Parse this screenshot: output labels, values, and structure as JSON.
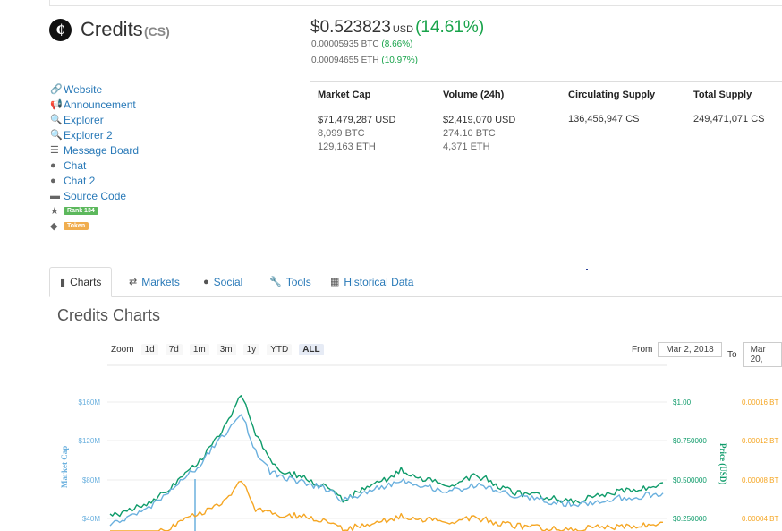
{
  "coin": {
    "name": "Credits",
    "symbol": "(CS)",
    "logo_glyph": "₵"
  },
  "price": {
    "usd": "$0.523823",
    "usd_unit": "USD",
    "usd_change": "(14.61%)",
    "btc": "0.00005935 BTC",
    "btc_change": "(8.66%)",
    "eth": "0.00094655 ETH",
    "eth_change": "(10.97%)"
  },
  "links": [
    {
      "icon": "link-icon",
      "glyph": "🔗",
      "label": "Website"
    },
    {
      "icon": "megaphone-icon",
      "glyph": "📢",
      "label": "Announcement"
    },
    {
      "icon": "search-icon",
      "glyph": "🔍",
      "label": "Explorer"
    },
    {
      "icon": "search-icon",
      "glyph": "🔍",
      "label": "Explorer 2"
    },
    {
      "icon": "list-icon",
      "glyph": "☰",
      "label": "Message Board"
    },
    {
      "icon": "globe-icon",
      "glyph": "●",
      "label": "Chat"
    },
    {
      "icon": "globe-icon",
      "glyph": "●",
      "label": "Chat 2"
    },
    {
      "icon": "hdd-icon",
      "glyph": "▬",
      "label": "Source Code"
    }
  ],
  "badges": {
    "rank": "Rank 134",
    "token": "Token",
    "rank_color": "#5cb85c",
    "token_color": "#f0ad4e"
  },
  "stats": {
    "headers": [
      "Market Cap",
      "Volume (24h)",
      "Circulating Supply",
      "Total Supply"
    ],
    "market_cap": [
      "$71,479,287 USD",
      "8,099 BTC",
      "129,163 ETH"
    ],
    "volume": [
      "$2,419,070 USD",
      "274.10 BTC",
      "4,371 ETH"
    ],
    "circulating": "136,456,947 CS",
    "total": "249,471,071 CS"
  },
  "tabs": [
    {
      "icon": "bar-chart-icon",
      "glyph": "▮",
      "label": "Charts",
      "active": true
    },
    {
      "icon": "exchange-icon",
      "glyph": "⇄",
      "label": "Markets"
    },
    {
      "icon": "globe-icon",
      "glyph": "●",
      "label": "Social"
    },
    {
      "icon": "wrench-icon",
      "glyph": "🔧",
      "label": "Tools"
    },
    {
      "icon": "calendar-icon",
      "glyph": "▦",
      "label": "Historical Data"
    }
  ],
  "charts_title": "Credits Charts",
  "zoom": {
    "label": "Zoom",
    "options": [
      "1d",
      "7d",
      "1m",
      "3m",
      "1y",
      "YTD",
      "ALL"
    ],
    "selected": "ALL"
  },
  "range": {
    "from_label": "From",
    "from_value": "Mar 2, 2018",
    "to_label": "To",
    "to_value": "Mar 20,"
  },
  "chart_data": {
    "type": "line",
    "left_axis_title": "Market Cap",
    "right_axis_title": "Price (USD)",
    "left_ticks": [
      "$160M",
      "$120M",
      "$80M",
      "$40M"
    ],
    "usd_ticks": [
      "$1.00",
      "$0.750000",
      "$0.500000",
      "$0.250000"
    ],
    "btc_ticks": [
      "0.00016 BT",
      "0.00012 BT",
      "0.00008 BT",
      "0.00004 BT"
    ],
    "colors": {
      "market_cap": "#6ab0de",
      "price_usd": "#0e9b6a",
      "price_btc": "#f5a623"
    },
    "series": [
      {
        "key": "price_usd",
        "values": [
          0.26,
          0.29,
          0.33,
          0.37,
          0.44,
          0.52,
          0.6,
          0.72,
          0.86,
          1.05,
          0.8,
          0.62,
          0.55,
          0.52,
          0.48,
          0.46,
          0.36,
          0.42,
          0.48,
          0.5,
          0.56,
          0.52,
          0.49,
          0.46,
          0.48,
          0.52,
          0.5,
          0.44,
          0.41,
          0.4,
          0.39,
          0.37,
          0.36,
          0.38,
          0.4,
          0.43,
          0.44,
          0.45,
          0.48
        ]
      },
      {
        "key": "market_cap",
        "values": [
          35,
          38,
          46,
          55,
          68,
          80,
          92,
          112,
          128,
          148,
          110,
          88,
          82,
          78,
          74,
          70,
          58,
          64,
          70,
          72,
          80,
          76,
          72,
          68,
          70,
          74,
          72,
          66,
          62,
          60,
          58,
          56,
          54,
          56,
          58,
          61,
          62,
          64,
          66
        ]
      },
      {
        "key": "price_btc",
        "values": [
          1.2e-05,
          1.5e-05,
          2e-05,
          2.5e-05,
          3e-05,
          3.8e-05,
          4.4e-05,
          5e-05,
          6e-05,
          8e-05,
          5e-05,
          4.6e-05,
          4.4e-05,
          4.2e-05,
          4e-05,
          3.8e-05,
          2.8e-05,
          3.2e-05,
          3.6e-05,
          3.8e-05,
          4.2e-05,
          4e-05,
          3.8e-05,
          3.6e-05,
          3.8e-05,
          4e-05,
          3.8e-05,
          3.4e-05,
          3.2e-05,
          3.1e-05,
          3e-05,
          2.9e-05,
          2.8e-05,
          3e-05,
          3.1e-05,
          3.2e-05,
          3.3e-05,
          3.4e-05,
          3.6e-05
        ]
      }
    ]
  }
}
